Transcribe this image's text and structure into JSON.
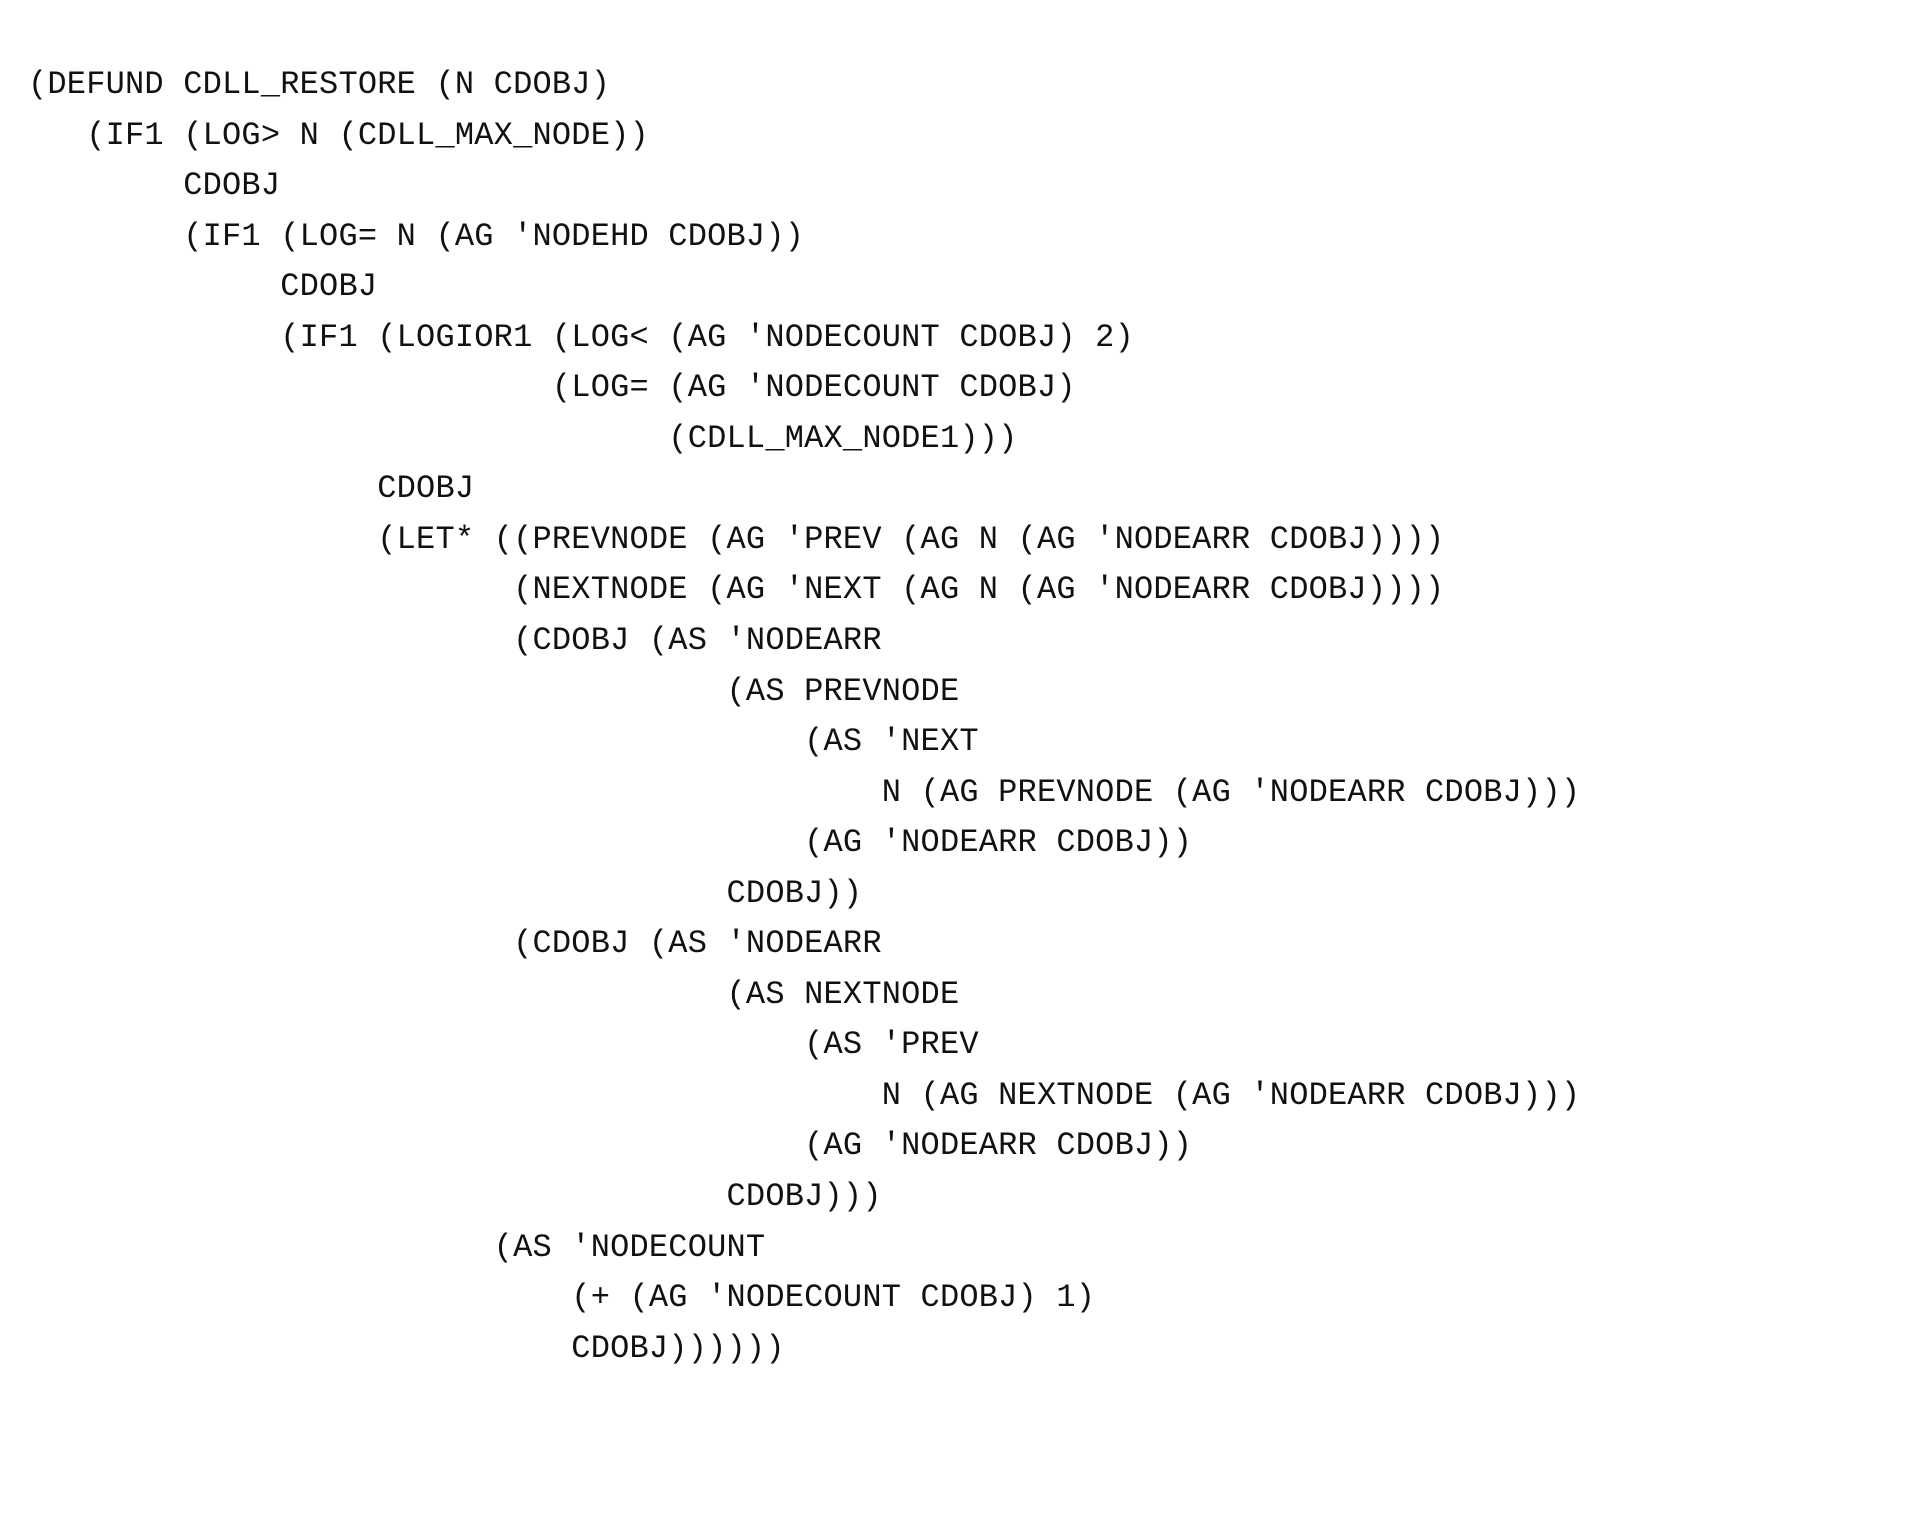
{
  "code": {
    "lines": [
      "(DEFUND CDLL_RESTORE (N CDOBJ)",
      "   (IF1 (LOG> N (CDLL_MAX_NODE))",
      "        CDOBJ",
      "        (IF1 (LOG= N (AG 'NODEHD CDOBJ))",
      "             CDOBJ",
      "             (IF1 (LOGIOR1 (LOG< (AG 'NODECOUNT CDOBJ) 2)",
      "                           (LOG= (AG 'NODECOUNT CDOBJ)",
      "                                 (CDLL_MAX_NODE1)))",
      "                  CDOBJ",
      "                  (LET* ((PREVNODE (AG 'PREV (AG N (AG 'NODEARR CDOBJ))))",
      "                         (NEXTNODE (AG 'NEXT (AG N (AG 'NODEARR CDOBJ))))",
      "                         (CDOBJ (AS 'NODEARR",
      "                                    (AS PREVNODE",
      "                                        (AS 'NEXT",
      "                                            N (AG PREVNODE (AG 'NODEARR CDOBJ)))",
      "                                        (AG 'NODEARR CDOBJ))",
      "                                    CDOBJ))",
      "                         (CDOBJ (AS 'NODEARR",
      "                                    (AS NEXTNODE",
      "                                        (AS 'PREV",
      "                                            N (AG NEXTNODE (AG 'NODEARR CDOBJ)))",
      "                                        (AG 'NODEARR CDOBJ))",
      "                                    CDOBJ)))",
      "                        (AS 'NODECOUNT",
      "                            (+ (AG 'NODECOUNT CDOBJ) 1)",
      "                            CDOBJ))))))"
    ]
  }
}
